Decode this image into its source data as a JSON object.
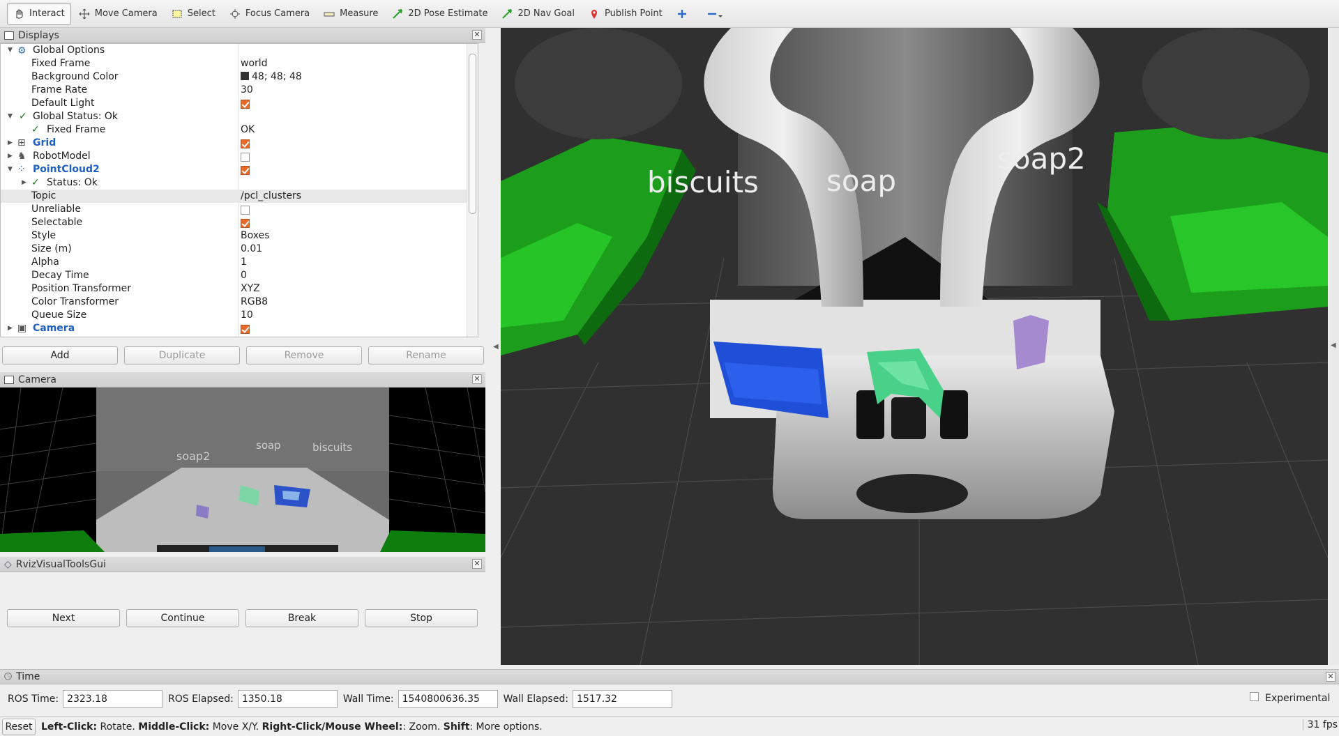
{
  "toolbar": {
    "tools": [
      "Interact",
      "Move Camera",
      "Select",
      "Focus Camera",
      "Measure",
      "2D Pose Estimate",
      "2D Nav Goal",
      "Publish Point"
    ]
  },
  "displays": {
    "title": "Displays",
    "rows": [
      {
        "label": "Global Options",
        "value": ""
      },
      {
        "label": "Fixed Frame",
        "value": "world"
      },
      {
        "label": "Background Color",
        "value": "48; 48; 48"
      },
      {
        "label": "Frame Rate",
        "value": "30"
      },
      {
        "label": "Default Light",
        "value": ""
      },
      {
        "label": "Global Status: Ok",
        "value": ""
      },
      {
        "label": "Fixed Frame",
        "value": "OK"
      },
      {
        "label": "Grid",
        "value": ""
      },
      {
        "label": "RobotModel",
        "value": ""
      },
      {
        "label": "PointCloud2",
        "value": ""
      },
      {
        "label": "Status: Ok",
        "value": ""
      },
      {
        "label": "Topic",
        "value": "/pcl_clusters"
      },
      {
        "label": "Unreliable",
        "value": ""
      },
      {
        "label": "Selectable",
        "value": ""
      },
      {
        "label": "Style",
        "value": "Boxes"
      },
      {
        "label": "Size (m)",
        "value": "0.01"
      },
      {
        "label": "Alpha",
        "value": "1"
      },
      {
        "label": "Decay Time",
        "value": "0"
      },
      {
        "label": "Position Transformer",
        "value": "XYZ"
      },
      {
        "label": "Color Transformer",
        "value": "RGB8"
      },
      {
        "label": "Queue Size",
        "value": "10"
      },
      {
        "label": "Camera",
        "value": ""
      }
    ],
    "buttons": {
      "add": "Add",
      "duplicate": "Duplicate",
      "remove": "Remove",
      "rename": "Rename"
    }
  },
  "camera_panel": {
    "title": "Camera",
    "labels": {
      "soap2": "soap2",
      "soap": "soap",
      "biscuits": "biscuits"
    }
  },
  "rviz_tools": {
    "title": "RvizVisualToolsGui",
    "buttons": {
      "next": "Next",
      "continue": "Continue",
      "break": "Break",
      "stop": "Stop"
    }
  },
  "viewport": {
    "labels": {
      "biscuits": "biscuits",
      "soap": "soap",
      "soap2": "soap2"
    }
  },
  "time": {
    "title": "Time",
    "ros_time_label": "ROS Time:",
    "ros_time": "2323.18",
    "ros_elapsed_label": "ROS Elapsed:",
    "ros_elapsed": "1350.18",
    "wall_time_label": "Wall Time:",
    "wall_time": "1540800636.35",
    "wall_elapsed_label": "Wall Elapsed:",
    "wall_elapsed": "1517.32",
    "experimental": "Experimental"
  },
  "status": {
    "reset": "Reset",
    "hint_b1": "Left-Click:",
    "hint_t1": " Rotate. ",
    "hint_b2": "Middle-Click:",
    "hint_t2": " Move X/Y. ",
    "hint_b3": "Right-Click/Mouse Wheel:",
    "hint_t3": ": Zoom. ",
    "hint_b4": "Shift",
    "hint_t4": ": More options.",
    "fps": "31 fps"
  },
  "colors": {
    "accent_check": "#e76a2a",
    "bg": "#303030",
    "green_bin": "#1fb31f",
    "blue_cluster": "#1e4fd6",
    "teal_cluster": "#4fd88e",
    "purple_cluster": "#a58ad0"
  }
}
